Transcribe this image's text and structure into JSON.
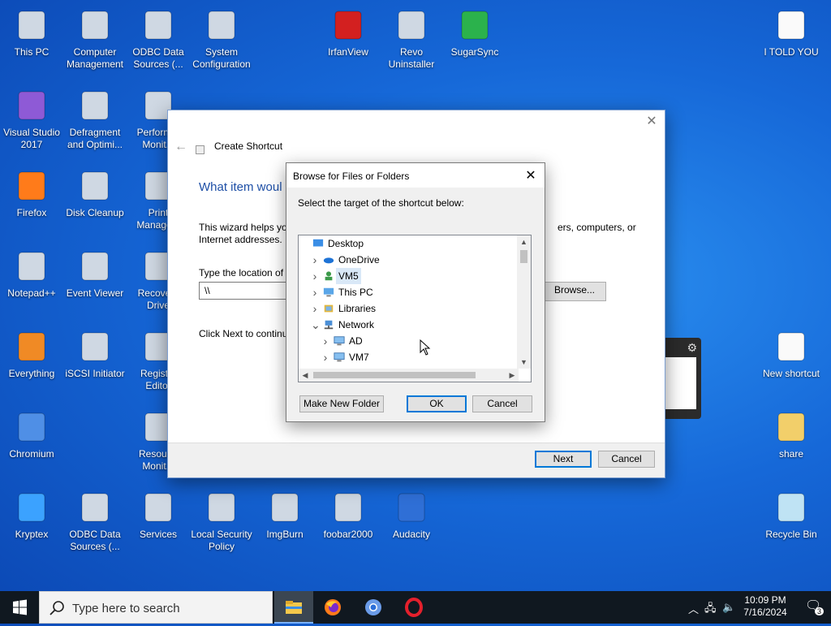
{
  "desktop_icons": [
    {
      "label": "This PC",
      "icon": "this-pc-icon"
    },
    {
      "label": "Computer Management",
      "icon": "computer-management-icon"
    },
    {
      "label": "ODBC Data Sources (...",
      "icon": "odbc-icon"
    },
    {
      "label": "System Configuration",
      "icon": "system-configuration-icon"
    },
    {
      "label": "IrfanView",
      "icon": "irfanview-icon"
    },
    {
      "label": "Revo Uninstaller",
      "icon": "revo-uninstaller-icon"
    },
    {
      "label": "SugarSync",
      "icon": "sugarsync-icon"
    },
    {
      "label": "I TOLD YOU",
      "icon": "text-file-icon"
    },
    {
      "label": "Visual Studio 2017",
      "icon": "visual-studio-icon"
    },
    {
      "label": "Defragment and Optimi...",
      "icon": "defragment-icon"
    },
    {
      "label": "Perform... Monit...",
      "icon": "performance-monitor-icon"
    },
    {
      "label": "Firefox",
      "icon": "firefox-icon"
    },
    {
      "label": "Disk Cleanup",
      "icon": "disk-cleanup-icon"
    },
    {
      "label": "Print Manage...",
      "icon": "print-management-icon"
    },
    {
      "label": "Notepad++",
      "icon": "notepadpp-icon"
    },
    {
      "label": "Event Viewer",
      "icon": "event-viewer-icon"
    },
    {
      "label": "Recove... Drive",
      "icon": "recovery-drive-icon"
    },
    {
      "label": "Everything",
      "icon": "everything-icon"
    },
    {
      "label": "iSCSI Initiator",
      "icon": "iscsi-icon"
    },
    {
      "label": "Regist... Editor",
      "icon": "registry-editor-icon"
    },
    {
      "label": "New shortcut",
      "icon": "shortcut-file-icon"
    },
    {
      "label": "Chromium",
      "icon": "chromium-icon"
    },
    {
      "label": "Resour... Monit...",
      "icon": "resource-monitor-icon"
    },
    {
      "label": "share",
      "icon": "folder-icon"
    },
    {
      "label": "Kryptex",
      "icon": "kryptex-icon"
    },
    {
      "label": "ODBC Data Sources (...",
      "icon": "odbc-icon"
    },
    {
      "label": "Services",
      "icon": "services-icon"
    },
    {
      "label": "Local Security Policy",
      "icon": "local-security-policy-icon"
    },
    {
      "label": "ImgBurn",
      "icon": "imgburn-icon"
    },
    {
      "label": "foobar2000",
      "icon": "foobar-icon"
    },
    {
      "label": "Audacity",
      "icon": "audacity-icon"
    },
    {
      "label": "Recycle Bin",
      "icon": "recycle-bin-icon"
    }
  ],
  "wizard": {
    "title": "Create Shortcut",
    "heading": "What item woul",
    "help_line1": "This wizard helps you",
    "help_line1_end": "ers, computers, or",
    "help_line2": "Internet addresses.",
    "location_label": "Type the location of t",
    "location_value": "\\\\",
    "browse_label": "Browse...",
    "click_next": "Click Next to continu",
    "next_label": "Next",
    "cancel_label": "Cancel"
  },
  "browse_dialog": {
    "title": "Browse for Files or Folders",
    "instruction": "Select the target of the shortcut below:",
    "tree": [
      {
        "label": "Desktop",
        "level": 0,
        "expander": "",
        "icon": "desktop-icon"
      },
      {
        "label": "OneDrive",
        "level": 1,
        "expander": ">",
        "icon": "onedrive-icon"
      },
      {
        "label": "VM5",
        "level": 1,
        "expander": ">",
        "icon": "user-icon",
        "selected": true
      },
      {
        "label": "This PC",
        "level": 1,
        "expander": ">",
        "icon": "this-pc-icon"
      },
      {
        "label": "Libraries",
        "level": 1,
        "expander": ">",
        "icon": "libraries-icon"
      },
      {
        "label": "Network",
        "level": 1,
        "expander": "v",
        "icon": "network-icon"
      },
      {
        "label": "AD",
        "level": 2,
        "expander": ">",
        "icon": "computer-icon"
      },
      {
        "label": "VM7",
        "level": 2,
        "expander": ">",
        "icon": "computer-icon"
      }
    ],
    "new_folder_label": "Make New Folder",
    "ok_label": "OK",
    "cancel_label": "Cancel"
  },
  "taskbar": {
    "search_placeholder": "Type here to search",
    "apps": [
      "file-explorer-icon",
      "firefox-icon",
      "chromium-icon",
      "opera-icon"
    ],
    "time": "10:09 PM",
    "date": "7/16/2024",
    "notification_count": "3"
  }
}
